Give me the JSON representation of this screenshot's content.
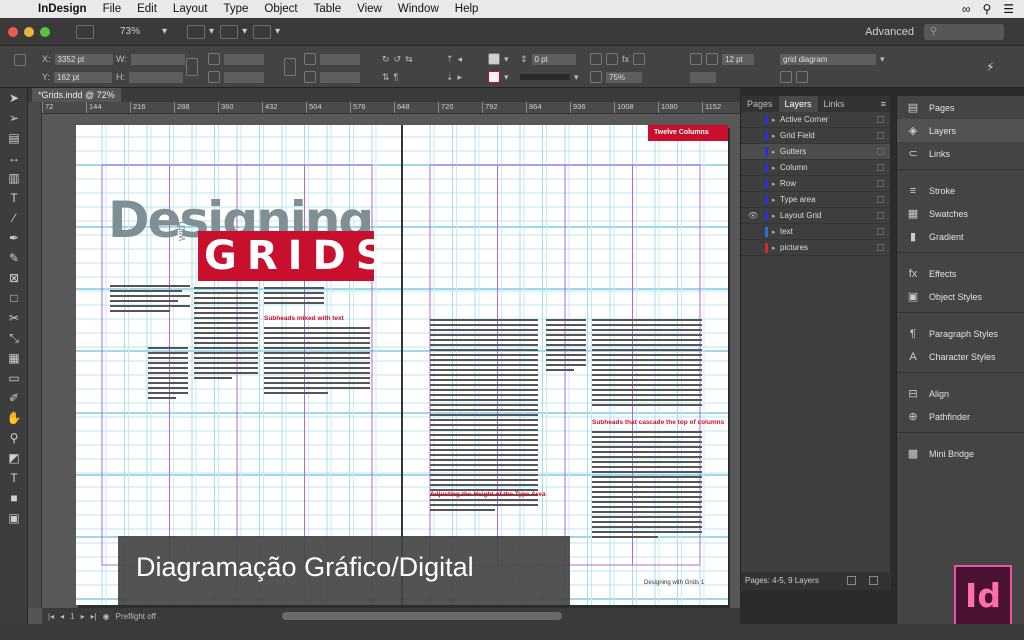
{
  "menubar": {
    "app": "InDesign",
    "items": [
      "File",
      "Edit",
      "Layout",
      "Type",
      "Object",
      "Table",
      "View",
      "Window",
      "Help"
    ]
  },
  "appbar": {
    "zoom": "73%",
    "workspace": "Advanced"
  },
  "control": {
    "x_label": "X:",
    "y_label": "Y:",
    "x_value": "3352 pt",
    "y_value": "162 pt",
    "w_label": "W:",
    "h_label": "H:",
    "stroke_weight": "0 pt",
    "percent": "75%",
    "right_field": "12 pt",
    "style_field": "grid diagram"
  },
  "document": {
    "tab": "*Grids.indd @ 72%",
    "ruler": [
      "72",
      "144",
      "216",
      "288",
      "360",
      "432",
      "504",
      "576",
      "648",
      "720",
      "792",
      "864",
      "936",
      "1008",
      "1080",
      "1152"
    ]
  },
  "page": {
    "headline": "Designing",
    "with": "with",
    "grids": "GRIDS",
    "red_label": "Twelve Columns",
    "subhead_1": "Subheads mixed with text",
    "subhead_2": "Adjusting the Height of the Type Area",
    "subhead_3": "Subheads that cascade the top of columns",
    "folio": "Designing with Grids  1"
  },
  "caption": "Diagramação Gráfico/Digital",
  "layers_panel": {
    "tabs": [
      "Pages",
      "Layers",
      "Links"
    ],
    "active_tab": "Layers",
    "layers": [
      {
        "name": "Active Corner",
        "color": "#2a2fd8"
      },
      {
        "name": "Grid Field",
        "color": "#2a2fd8"
      },
      {
        "name": "Gutters",
        "color": "#2a2fd8"
      },
      {
        "name": "Column",
        "color": "#2a2fd8"
      },
      {
        "name": "Row",
        "color": "#2a2fd8"
      },
      {
        "name": "Type area",
        "color": "#2a2fd8"
      },
      {
        "name": "Layout Grid",
        "color": "#2a2fd8"
      },
      {
        "name": "text",
        "color": "#2a6fd8"
      },
      {
        "name": "pictures",
        "color": "#d82a2a"
      }
    ],
    "footer": "Pages: 4-5, 9 Layers"
  },
  "right_panels": [
    "Pages",
    "Layers",
    "Links",
    "Stroke",
    "Swatches",
    "Gradient",
    "Effects",
    "Object Styles",
    "Paragraph Styles",
    "Character Styles",
    "Align",
    "Pathfinder",
    "Mini Bridge"
  ],
  "logo": "Id",
  "status": {
    "page": "1",
    "preflight": "Preflight off"
  }
}
